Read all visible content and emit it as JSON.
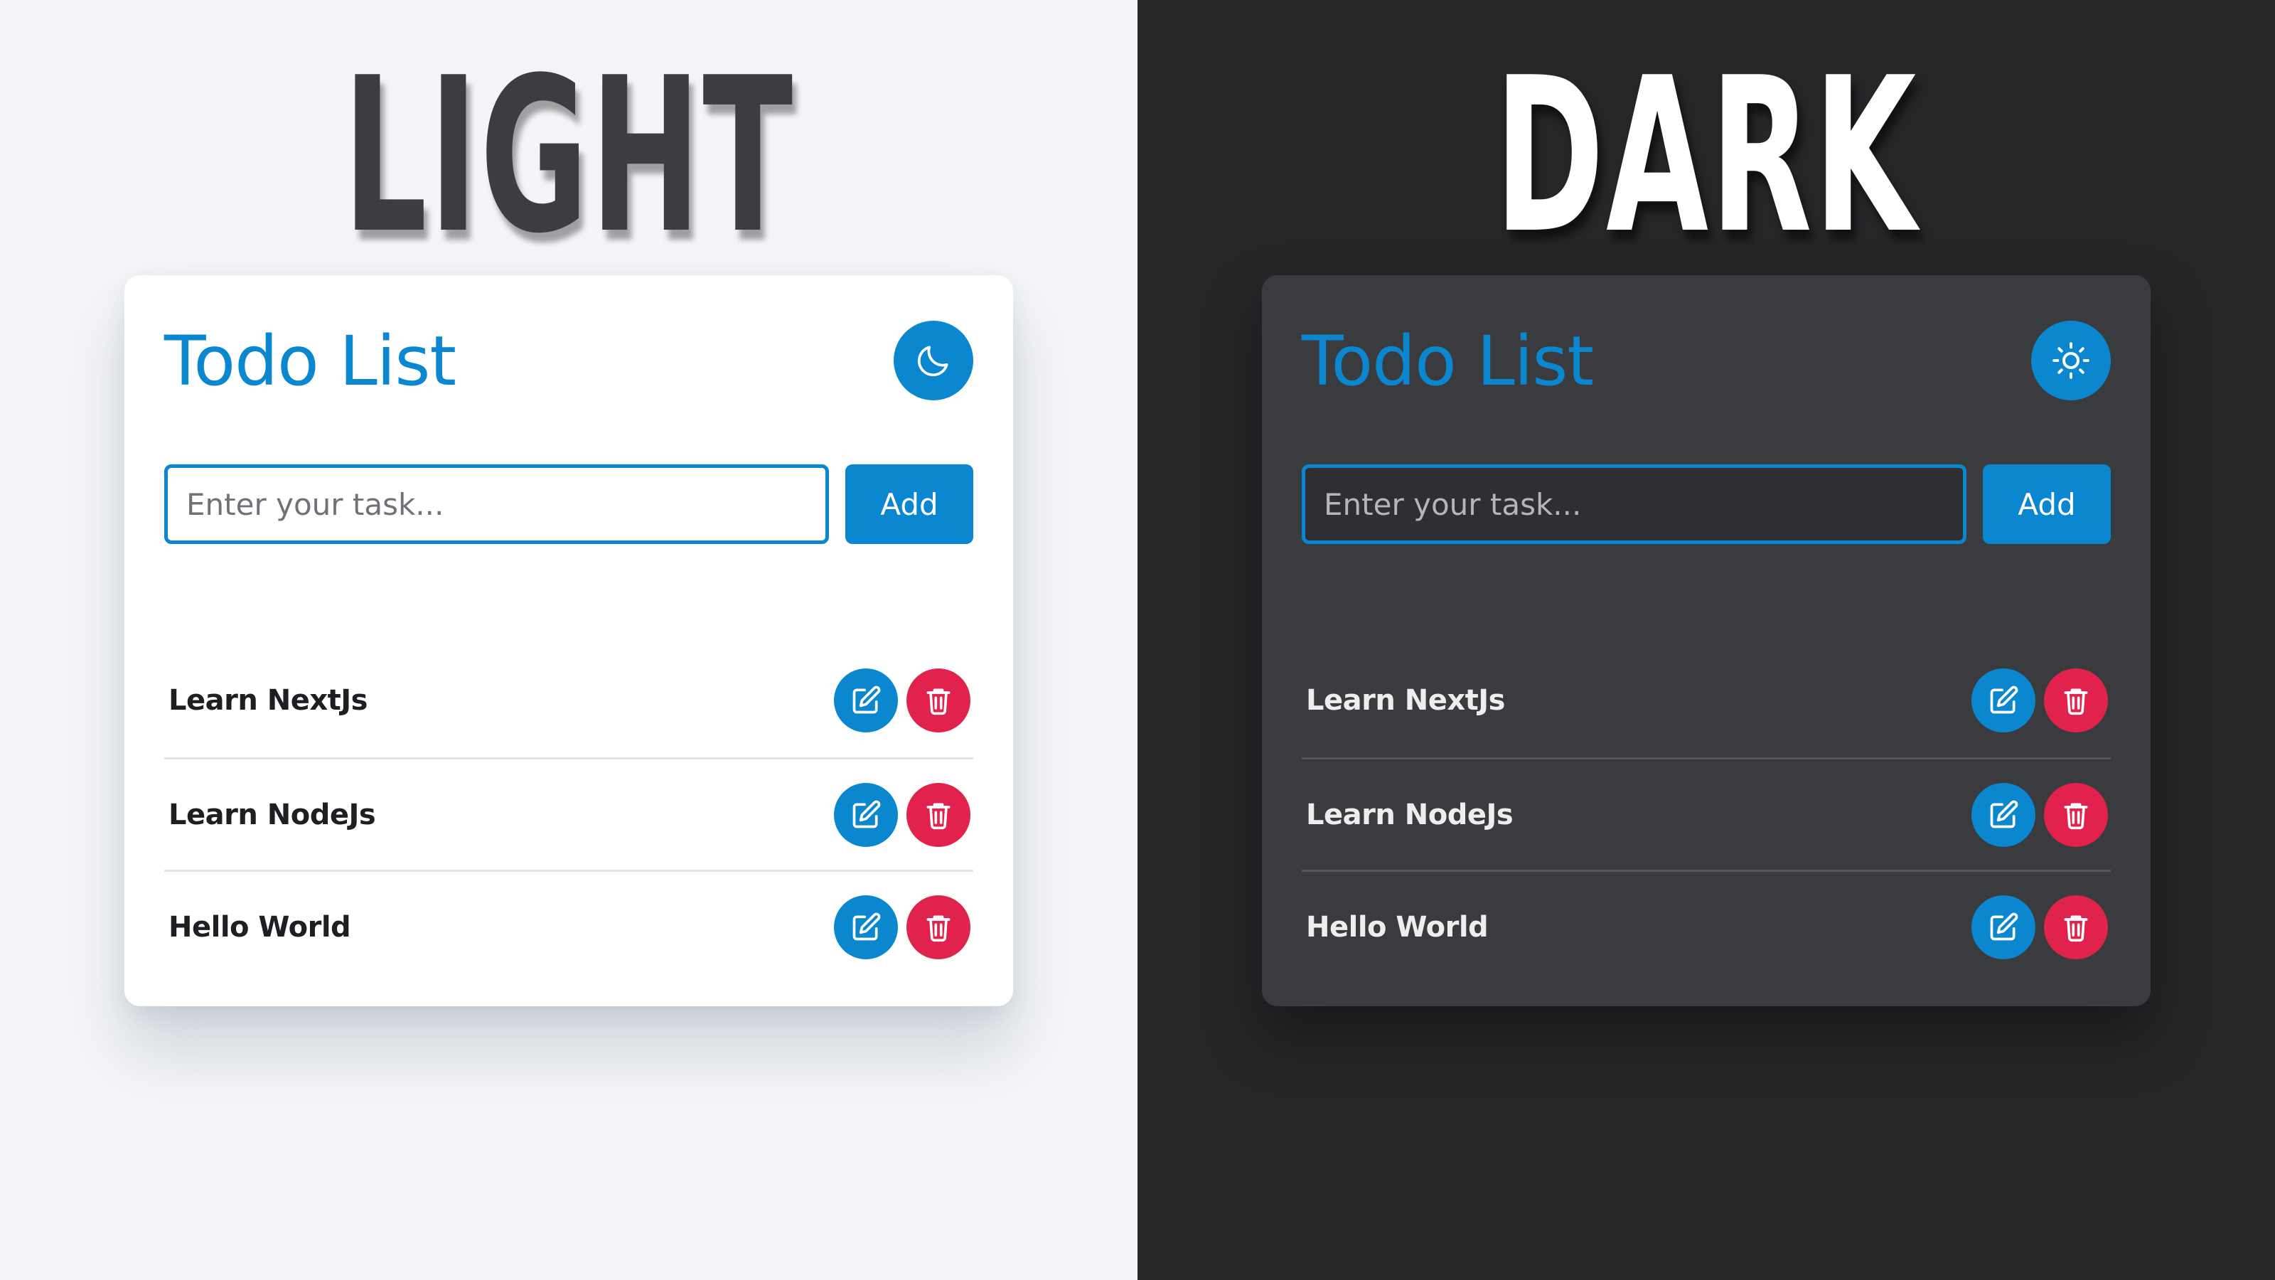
{
  "colors": {
    "accent": "#0a87cf",
    "danger": "#e0224d",
    "light_bg": "#f4f5f8",
    "dark_bg": "#262629",
    "dark_card": "#3a3b3f"
  },
  "light": {
    "banner": "LIGHT",
    "app": {
      "title": "Todo List",
      "theme_toggle_icon": "moon-icon",
      "input": {
        "placeholder": "Enter your task...",
        "value": ""
      },
      "add_label": "Add",
      "todos": [
        {
          "text": "Learn NextJs",
          "edit_icon": "edit-icon",
          "delete_icon": "trash-icon"
        },
        {
          "text": "Learn NodeJs",
          "edit_icon": "edit-icon",
          "delete_icon": "trash-icon"
        },
        {
          "text": "Hello World",
          "edit_icon": "edit-icon",
          "delete_icon": "trash-icon"
        }
      ]
    }
  },
  "dark": {
    "banner": "DARK",
    "app": {
      "title": "Todo List",
      "theme_toggle_icon": "sun-icon",
      "input": {
        "placeholder": "Enter your task...",
        "value": ""
      },
      "add_label": "Add",
      "todos": [
        {
          "text": "Learn NextJs",
          "edit_icon": "edit-icon",
          "delete_icon": "trash-icon"
        },
        {
          "text": "Learn NodeJs",
          "edit_icon": "edit-icon",
          "delete_icon": "trash-icon"
        },
        {
          "text": "Hello World",
          "edit_icon": "edit-icon",
          "delete_icon": "trash-icon"
        }
      ]
    }
  }
}
